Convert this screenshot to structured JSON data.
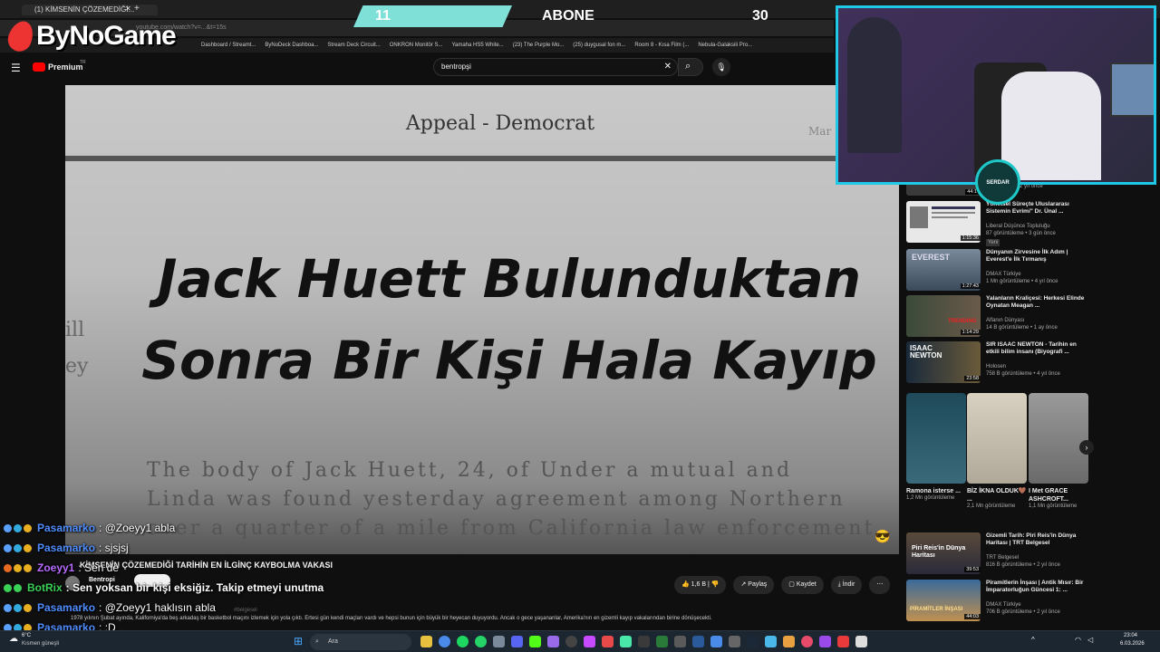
{
  "browser": {
    "tab_title": "(1) KİMSENİN ÇÖZEMEDİĞİ...",
    "address": "youtube.com/watch?v=...&t=15s",
    "bookmarks": [
      "Dashboard / Streamt...",
      "ByNoDeck Dashboa...",
      "Stream Deck Circuit...",
      "ONKRON Monitör S...",
      "Yamaha HS5 White...",
      "(23) The Purple Mo...",
      "(25) duygusal fon m...",
      "Room 8 - Kısa Film (...",
      "Nebula-Galaksili Pro..."
    ]
  },
  "overlay": {
    "logo": "ByNoGame",
    "alert_left": "11",
    "alert_label": "ABONE",
    "alert_right": "30"
  },
  "youtube": {
    "brand": "Premium",
    "brand_suffix": "TR",
    "search_value": "bentropşi"
  },
  "video": {
    "paper_header": "Appeal - Democrat",
    "paper_side": "Mar",
    "headline_line1": "Jack Huett Bulunduktan",
    "headline_line2": "Sonra Bir Kişi Hala Kayıp",
    "paper_text_1": "The body of Jack Huett, 24, of      Under a mutual  and",
    "paper_text_2": "Linda was found yesterday   agreement among  Northern",
    "paper_text_3": "over a quarter of a mile from   California law  enforcement",
    "left_col": [
      "ill",
      "ey"
    ],
    "title": "KİMSENİN ÇÖZEMEDİĞİ TARİHİN EN İLGİNÇ KAYBOLMA VAKASI",
    "channel": "Bentropi",
    "views_line": "1978 yılının Şubat ayında, Kaliforniya'da beş arkadaş bir basketbol maçını izlemek için yola çıktı. Ertesi gün kendi maçları vardı ve hepsi bunun için büyük bir heyecan duyuyordu. Ancak o gece yaşananlar, Amerika'nın en gizemli kayıp vakalarından birine dönüşecekti.",
    "hashtags": "#belgesel",
    "likes": "1,6 B",
    "share": "Paylaş",
    "save": "Kaydet",
    "download": "İndir"
  },
  "chat": [
    {
      "user": "Pasamarko",
      "text": ": @Zoeyy1 abla",
      "color": "#4f8dff"
    },
    {
      "user": "Pasamarko",
      "text": ": sjsjsj",
      "color": "#4f8dff"
    },
    {
      "user": "Zoeyy1",
      "text": ": Sen de",
      "color": "#b76bff"
    },
    {
      "user": "BotRix",
      "text": ": Sen yoksan bir kişi eksiğiz. Takip etmeyi unutma",
      "color": "#3ad157"
    },
    {
      "user": "Pasamarko",
      "text": ": @Zoeyy1 haklısın abla",
      "color": "#4f8dff"
    },
    {
      "user": "Pasamarko",
      "text": ": :D",
      "color": "#4f8dff"
    }
  ],
  "sidebar": {
    "top_meta": "2 yıl önce",
    "top_dur": "44:1",
    "videos": [
      {
        "title": "Yönetsel Süreçte Uluslararası Sistemin Evrimi\" Dr. Ünal ...",
        "channel": "Liberal Düşünce Topluluğu",
        "meta": "87 görüntüleme • 3 gün önce",
        "badge": "Yeni",
        "dur": "1:15:36",
        "color": "#e8e8e8"
      },
      {
        "title": "Dünyanın Zirvesine İlk Adım | Everest'e İlk Tırmanış",
        "channel": "DMAX Türkiye",
        "meta": "1 Mn görüntüleme • 4 yıl önce",
        "dur": "1:27:43",
        "color": "#5a6b7a"
      },
      {
        "title": "Yalanların Kraliçesi: Herkesi Elinde Oynatan Meagan ...",
        "channel": "Alfanın Dünyası",
        "meta": "14 B görüntüleme • 1 ay önce",
        "dur": "1:14:29",
        "color": "#3b4a3a"
      },
      {
        "title": "SIR ISAAC NEWTON - Tarihin en etkili bilim insanı (Biyografi ...",
        "channel": "Holosen",
        "meta": "758 B görüntüleme • 4 yıl önce",
        "dur": "23:58",
        "color": "#2a3a4a"
      },
      {
        "title": "Gizemli Tarih: Piri Reis'in Dünya Haritası | TRT Belgesel",
        "channel": "TRT Belgesel",
        "meta": "816 B görüntüleme • 2 yıl önce",
        "dur": "39:53",
        "color": "#4a3a2a"
      },
      {
        "title": "Piramitlerin İnşası | Antik Mısır: Bir İmparatorluğun Güncesi 1: ...",
        "channel": "DMAX Türkiye",
        "meta": "706 B görüntüleme • 2 yıl önce",
        "dur": "44:03",
        "color": "#b08850"
      }
    ],
    "shorts": [
      {
        "title": "Ramona isterse ...",
        "meta": "1,2 Mn görüntüleme",
        "color": "#2c5a6a"
      },
      {
        "title": "BİZ İKNA OLDUK🤎 ...",
        "meta": "2,1 Mn görüntüleme",
        "color": "#cfc6b5"
      },
      {
        "title": "I Met GRACE ASHCROFT...",
        "meta": "1,1 Mn görüntüleme",
        "color": "#8a8a8a"
      }
    ],
    "thumb_texts": [
      "EVEREST",
      "TRENDING",
      "ISAAC NEWTON",
      "Piri Reis'in Dünya Haritası",
      "PİRAMİTLER İNŞASI"
    ]
  },
  "webcam": {
    "badge": "SERDAR"
  },
  "taskbar": {
    "search_placeholder": "Ara",
    "weather_temp": "6°C",
    "weather_text": "Kısmen güneşli",
    "time": "23:04",
    "date": "6.03.2026"
  }
}
